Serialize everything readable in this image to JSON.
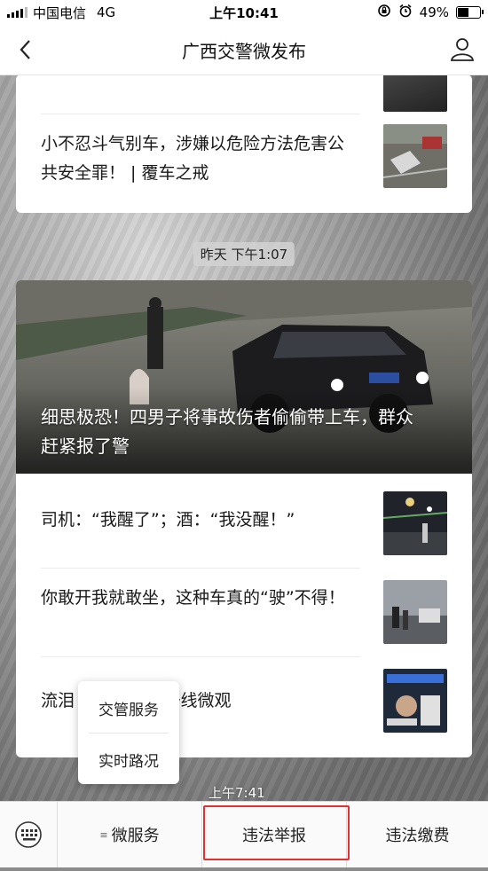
{
  "status_bar": {
    "carrier": "中国电信",
    "network": "4G",
    "time": "上午10:41",
    "battery": "49%"
  },
  "nav": {
    "title": "广西交警微发布"
  },
  "articles_top": [
    {
      "title": "小不忍斗气别车，涉嫌以危险方法危害公共安全罪！ | 覆车之戒"
    }
  ],
  "timestamp_1": "昨天 下午1:07",
  "featured": {
    "title": "细思极恐！四男子将事故伤者偷偷带上车，群众赶紧报了警"
  },
  "articles": [
    {
      "title": "司机：“我醒了”；酒：“我没醒！”"
    },
    {
      "title": "你敢开我就敢坐，这种车真的“驶”不得！"
    },
    {
      "title": "流泪  晚了…… | 一线微观"
    }
  ],
  "popup_menu": {
    "items": [
      "交管服务",
      "实时路况"
    ]
  },
  "timestamp_2": "上午7:41",
  "menu_bar": {
    "items": [
      "微服务",
      "违法举报",
      "违法缴费"
    ]
  }
}
